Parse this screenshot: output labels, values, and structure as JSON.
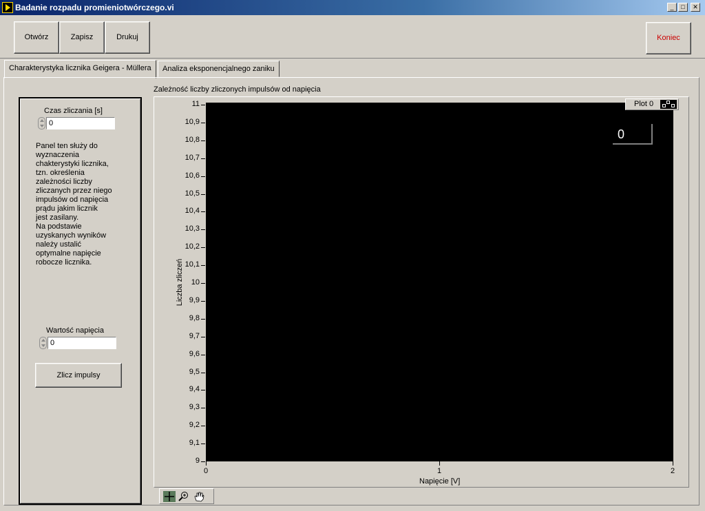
{
  "window": {
    "title": "Badanie rozpadu promieniotwórczego.vi",
    "controls": [
      "minimize-icon",
      "maximize-icon",
      "close-icon"
    ]
  },
  "toolbar": {
    "open_label": "Otwórz",
    "save_label": "Zapisz",
    "print_label": "Drukuj",
    "exit_label": "Koniec",
    "exit_color": "#cc0000"
  },
  "tabs": [
    {
      "label": "Charakterystyka licznika Geigera - Müllera",
      "active": true
    },
    {
      "label": "Analiza eksponencjalnego zaniku",
      "active": false
    }
  ],
  "left_panel": {
    "count_time_label": "Czas zliczania [s]",
    "count_time_value": "0",
    "description_lines": [
      "Panel ten służy do",
      "wyznaczenia",
      "chakterystyki licznika,",
      "tzn. określenia",
      "zależności liczby",
      "zliczanych przez niego",
      "impulsów od napięcia",
      "prądu jakim licznik",
      "jest zasilany.",
      "Na podstawie",
      "uzyskanych wyników",
      "należy ustalić",
      "optymalne napięcie",
      "robocze licznika."
    ],
    "voltage_label": "Wartość napięcia",
    "voltage_value": "0",
    "count_button_label": "Zlicz impulsy"
  },
  "graph": {
    "digital_display": "0",
    "palette_tools": [
      "crosshair-icon",
      "zoom-icon",
      "pan-hand-icon"
    ]
  },
  "chart_data": {
    "type": "line",
    "title": "Zależność liczby zliczonych impulsów od napięcia",
    "xlabel": "Napięcie [V]",
    "ylabel": "Liczba zliczeń",
    "xlim": [
      0,
      2
    ],
    "ylim": [
      9,
      11
    ],
    "x_ticks": [
      "0",
      "1",
      "2"
    ],
    "y_ticks": [
      "11",
      "10,9",
      "10,8",
      "10,7",
      "10,6",
      "10,5",
      "10,4",
      "10,3",
      "10,2",
      "10,1",
      "10",
      "9,9",
      "9,8",
      "9,7",
      "9,6",
      "9,5",
      "9,4",
      "9,3",
      "9,2",
      "9,1",
      "9"
    ],
    "legend": {
      "placement": "top-right"
    },
    "series": [
      {
        "name": "Plot 0",
        "x": [],
        "y": []
      }
    ],
    "background": "#000000",
    "grid": false
  }
}
